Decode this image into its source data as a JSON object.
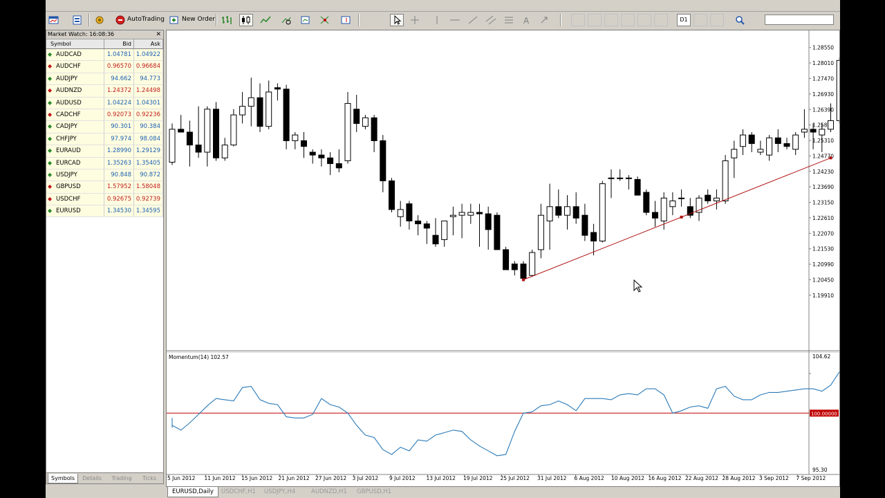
{
  "toolbar": {
    "autotrading_label": "AutoTrading",
    "new_order_label": "New Order",
    "timeframe_label": "D1"
  },
  "market_watch": {
    "title": "Market Watch: 16:08:36",
    "columns": [
      "Symbol",
      "Bid",
      "Ask"
    ],
    "rows": [
      {
        "symbol": "AUDCAD",
        "bid": "1.04781",
        "ask": "1.04922",
        "dir": "up"
      },
      {
        "symbol": "AUDCHF",
        "bid": "0.96570",
        "ask": "0.96684",
        "dir": "dn"
      },
      {
        "symbol": "AUDJPY",
        "bid": "94.662",
        "ask": "94.773",
        "dir": "up"
      },
      {
        "symbol": "AUDNZD",
        "bid": "1.24372",
        "ask": "1.24498",
        "dir": "dn"
      },
      {
        "symbol": "AUDUSD",
        "bid": "1.04224",
        "ask": "1.04301",
        "dir": "up"
      },
      {
        "symbol": "CADCHF",
        "bid": "0.92073",
        "ask": "0.92236",
        "dir": "dn"
      },
      {
        "symbol": "CADJPY",
        "bid": "90.301",
        "ask": "90.384",
        "dir": "up"
      },
      {
        "symbol": "CHFJPY",
        "bid": "97.974",
        "ask": "98.084",
        "dir": "up"
      },
      {
        "symbol": "EURAUD",
        "bid": "1.28990",
        "ask": "1.29129",
        "dir": "up"
      },
      {
        "symbol": "EURCAD",
        "bid": "1.35263",
        "ask": "1.35405",
        "dir": "up"
      },
      {
        "symbol": "USDJPY",
        "bid": "90.848",
        "ask": "90.872",
        "dir": "up"
      },
      {
        "symbol": "GBPUSD",
        "bid": "1.57952",
        "ask": "1.58048",
        "dir": "dn"
      },
      {
        "symbol": "USDCHF",
        "bid": "0.92675",
        "ask": "0.92739",
        "dir": "dn"
      },
      {
        "symbol": "EURUSD",
        "bid": "1.34530",
        "ask": "1.34595",
        "dir": "up"
      }
    ],
    "tabs": [
      "Symbols",
      "Details",
      "Trading",
      "Ticks"
    ]
  },
  "chart_tabs": [
    "EURUSD,Daily",
    "USDCHF,H1",
    "USDJPY,H4",
    "AUDNZD,H1",
    "GBPUSD,H1"
  ],
  "colors": {
    "trendline": "#b01010",
    "momentum": "#2a7ab8",
    "level100": "#c00000",
    "bull": "#ffffff",
    "bear": "#000000"
  },
  "chart_data": {
    "type": "candlestick",
    "symbol": "EURUSD",
    "timeframe": "Daily",
    "price_axis": {
      "min": 1.18,
      "max": 1.2905,
      "ticks": [
        "1.28550",
        "1.28010",
        "1.27470",
        "1.26930",
        "1.26390",
        "1.25850",
        "1.25310",
        "1.24770",
        "1.24230",
        "1.23690",
        "1.23150",
        "1.22610",
        "1.22070",
        "1.21530",
        "1.20990",
        "1.20450",
        "1.19910"
      ]
    },
    "date_ticks": [
      "5 Jun 2012",
      "11 Jun 2012",
      "15 Jun 2012",
      "21 Jun 2012",
      "27 Jun 2012",
      "3 Jul 2012",
      "9 Jul 2012",
      "13 Jul 2012",
      "19 Jul 2012",
      "25 Jul 2012",
      "31 Jul 2012",
      "6 Aug 2012",
      "10 Aug 2012",
      "16 Aug 2012",
      "22 Aug 2012",
      "28 Aug 2012",
      "3 Sep 2012",
      "7 Sep 2012"
    ],
    "candles": [
      [
        1.2455,
        1.259,
        1.2445,
        1.257
      ],
      [
        1.257,
        1.262,
        1.256,
        1.256
      ],
      [
        1.256,
        1.26,
        1.244,
        1.2515
      ],
      [
        1.2515,
        1.265,
        1.247,
        1.249
      ],
      [
        1.249,
        1.265,
        1.244,
        1.264
      ],
      [
        1.264,
        1.2665,
        1.246,
        1.247
      ],
      [
        1.247,
        1.254,
        1.246,
        1.2515
      ],
      [
        1.2515,
        1.264,
        1.251,
        1.262
      ],
      [
        1.262,
        1.27,
        1.259,
        1.265
      ],
      [
        1.265,
        1.275,
        1.258,
        1.268
      ],
      [
        1.268,
        1.273,
        1.256,
        1.258
      ],
      [
        1.258,
        1.274,
        1.257,
        1.27
      ],
      [
        1.2715,
        1.273,
        1.267,
        1.271
      ],
      [
        1.271,
        1.2725,
        1.25,
        1.253
      ],
      [
        1.253,
        1.256,
        1.25,
        1.255
      ],
      [
        1.253,
        1.256,
        1.247,
        1.251
      ],
      [
        1.249,
        1.25,
        1.245,
        1.248
      ],
      [
        1.248,
        1.25,
        1.244,
        1.247
      ],
      [
        1.247,
        1.249,
        1.241,
        1.245
      ],
      [
        1.245,
        1.25,
        1.242,
        1.2435
      ],
      [
        1.246,
        1.27,
        1.245,
        1.266
      ],
      [
        1.264,
        1.269,
        1.256,
        1.259
      ],
      [
        1.258,
        1.262,
        1.257,
        1.261
      ],
      [
        1.261,
        1.262,
        1.249,
        1.253
      ],
      [
        1.253,
        1.255,
        1.235,
        1.239
      ],
      [
        1.239,
        1.24,
        1.228,
        1.229
      ],
      [
        1.2265,
        1.232,
        1.223,
        1.229
      ],
      [
        1.231,
        1.232,
        1.222,
        1.225
      ],
      [
        1.225,
        1.227,
        1.22,
        1.224
      ],
      [
        1.224,
        1.225,
        1.217,
        1.2225
      ],
      [
        1.22,
        1.226,
        1.216,
        1.217
      ],
      [
        1.2185,
        1.225,
        1.216,
        1.225
      ],
      [
        1.2265,
        1.23,
        1.22,
        1.227
      ],
      [
        1.227,
        1.231,
        1.219,
        1.228
      ],
      [
        1.227,
        1.231,
        1.224,
        1.228
      ],
      [
        1.228,
        1.231,
        1.216,
        1.2275
      ],
      [
        1.2275,
        1.23,
        1.215,
        1.222
      ],
      [
        1.227,
        1.228,
        1.215,
        1.215
      ],
      [
        1.215,
        1.216,
        1.208,
        1.208
      ],
      [
        1.21,
        1.211,
        1.206,
        1.208
      ],
      [
        1.21,
        1.211,
        1.2045,
        1.205
      ],
      [
        1.206,
        1.215,
        1.2055,
        1.214
      ],
      [
        1.215,
        1.231,
        1.212,
        1.227
      ],
      [
        1.225,
        1.238,
        1.215,
        1.23
      ],
      [
        1.23,
        1.236,
        1.226,
        1.227
      ],
      [
        1.227,
        1.234,
        1.222,
        1.23
      ],
      [
        1.23,
        1.235,
        1.224,
        1.226
      ],
      [
        1.227,
        1.231,
        1.218,
        1.22
      ],
      [
        1.221,
        1.224,
        1.213,
        1.218
      ],
      [
        1.218,
        1.239,
        1.2175,
        1.238
      ],
      [
        1.24,
        1.243,
        1.233,
        1.24
      ],
      [
        1.24,
        1.243,
        1.239,
        1.24
      ],
      [
        1.24,
        1.241,
        1.236,
        1.24
      ],
      [
        1.2395,
        1.2405,
        1.234,
        1.234
      ],
      [
        1.235,
        1.236,
        1.227,
        1.228
      ],
      [
        1.228,
        1.232,
        1.223,
        1.226
      ],
      [
        1.225,
        1.235,
        1.222,
        1.233
      ],
      [
        1.23,
        1.235,
        1.227,
        1.232
      ],
      [
        1.233,
        1.236,
        1.23,
        1.233
      ],
      [
        1.23,
        1.233,
        1.226,
        1.227
      ],
      [
        1.228,
        1.234,
        1.225,
        1.233
      ],
      [
        1.234,
        1.236,
        1.231,
        1.232
      ],
      [
        1.232,
        1.236,
        1.229,
        1.233
      ],
      [
        1.232,
        1.248,
        1.231,
        1.246
      ],
      [
        1.247,
        1.253,
        1.24,
        1.25
      ],
      [
        1.251,
        1.257,
        1.248,
        1.255
      ],
      [
        1.255,
        1.256,
        1.249,
        1.252
      ],
      [
        1.249,
        1.253,
        1.248,
        1.25
      ],
      [
        1.248,
        1.255,
        1.246,
        1.254
      ],
      [
        1.254,
        1.257,
        1.249,
        1.252
      ],
      [
        1.252,
        1.254,
        1.25,
        1.251
      ],
      [
        1.25,
        1.256,
        1.248,
        1.255
      ],
      [
        1.256,
        1.264,
        1.254,
        1.257
      ],
      [
        1.257,
        1.259,
        1.25,
        1.256
      ],
      [
        1.255,
        1.259,
        1.249,
        1.257
      ],
      [
        1.257,
        1.266,
        1.256,
        1.26
      ],
      [
        1.26,
        1.282,
        1.259,
        1.281
      ],
      [
        1.279,
        1.281,
        1.276,
        1.276
      ],
      [
        1.276,
        1.287,
        1.275,
        1.285
      ]
    ],
    "trendline": {
      "start": {
        "candle": 40,
        "price": 1.2045
      },
      "end": {
        "candle": 75,
        "price": 1.247
      }
    },
    "indicator": {
      "label": "Momentum(14) 102.57",
      "name": "Momentum(14)",
      "current": 102.57,
      "range": [
        95.3,
        104.62
      ],
      "ticks": [
        "104.62",
        "95.30"
      ],
      "level": "100.00000",
      "level_value": 100.0,
      "values": [
        98.8,
        99.6,
        99.0,
        98.6,
        99.2,
        99.9,
        100.6,
        101.2,
        101.1,
        101.0,
        102.1,
        102.2,
        101.1,
        100.8,
        100.7,
        99.7,
        99.6,
        99.6,
        99.9,
        101.2,
        100.7,
        100.5,
        100.0,
        99.0,
        98.2,
        98.0,
        97.0,
        96.6,
        97.2,
        96.9,
        97.8,
        97.7,
        98.2,
        98.4,
        98.6,
        98.5,
        97.8,
        97.3,
        96.9,
        96.5,
        96.6,
        98.5,
        100.0,
        100.1,
        100.6,
        100.7,
        101.0,
        100.7,
        100.2,
        101.2,
        101.2,
        101.2,
        101.1,
        101.5,
        101.6,
        101.5,
        102.0,
        102.0,
        101.5,
        100.0,
        100.2,
        100.5,
        100.6,
        100.4,
        102.0,
        102.2,
        101.4,
        101.1,
        101.1,
        101.5,
        101.7,
        101.7,
        101.8,
        101.9,
        102.0,
        102.0,
        101.8,
        102.3,
        103.4,
        102.4,
        102.6
      ],
      "color": "#2a7ab8"
    }
  }
}
